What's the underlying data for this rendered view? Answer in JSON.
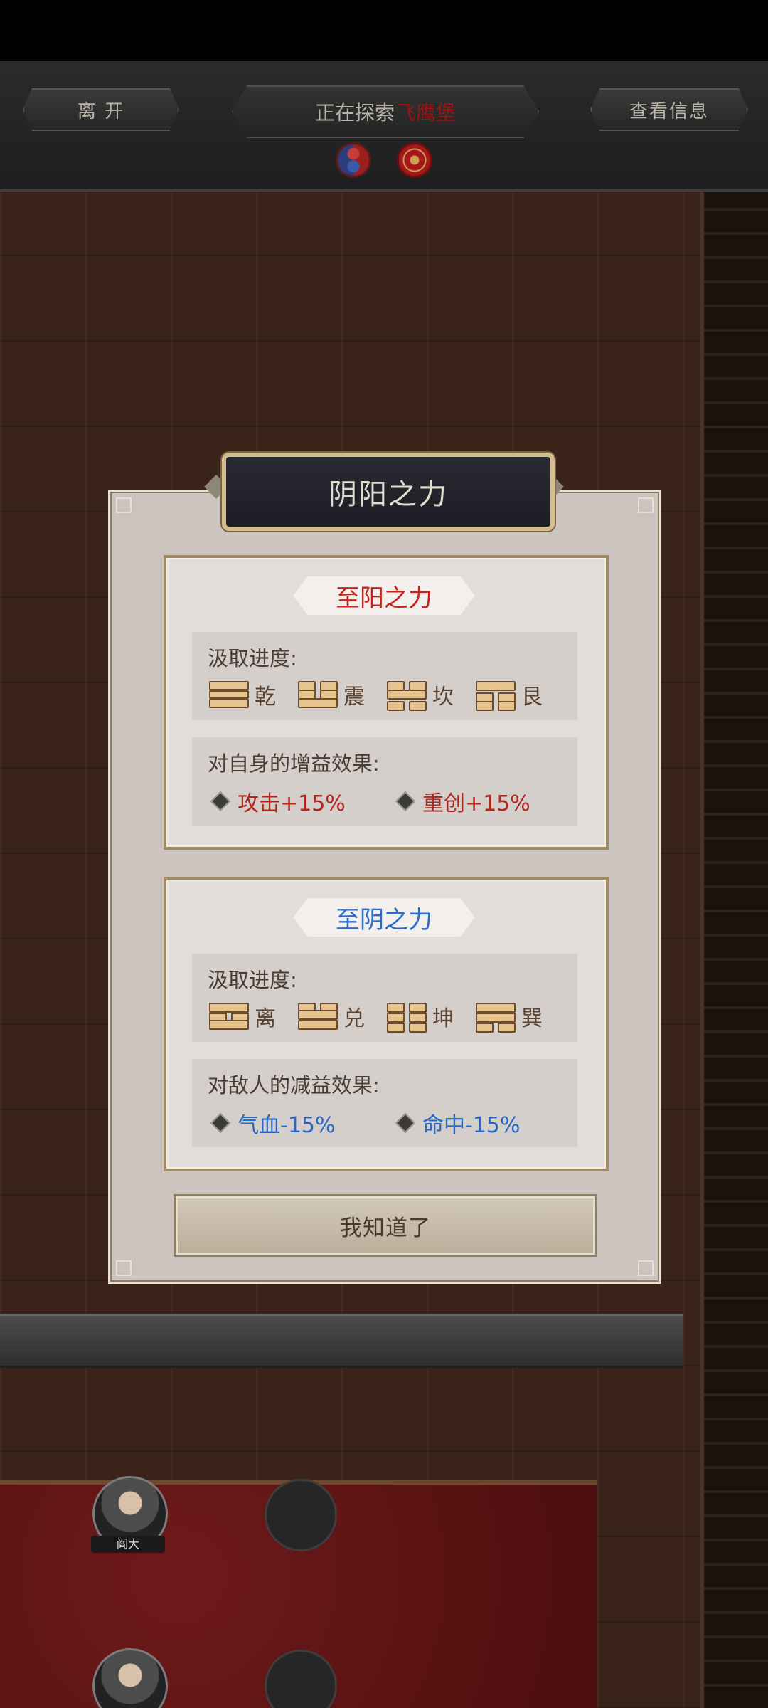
{
  "top_bar": {
    "leave_label": "离 开",
    "explore_prefix": "正在探索",
    "explore_location": "飞鹰堡",
    "info_label": "查看信息"
  },
  "icons": {
    "yinyang": "yinyang-icon",
    "bagua": "bagua-icon"
  },
  "board": {
    "character_label": "阎大"
  },
  "modal": {
    "title": "阴阳之力",
    "yang": {
      "title": "至阳之力",
      "progress_label": "汲取进度:",
      "trigrams": [
        "乾",
        "震",
        "坎",
        "艮"
      ],
      "effect_label": "对自身的增益效果:",
      "effects": [
        "攻击+15%",
        "重创+15%"
      ]
    },
    "yin": {
      "title": "至阴之力",
      "progress_label": "汲取进度:",
      "trigrams": [
        "离",
        "兑",
        "坤",
        "巽"
      ],
      "effect_label": "对敌人的减益效果:",
      "effects": [
        "气血-15%",
        "命中-15%"
      ]
    },
    "ok_label": "我知道了"
  },
  "colors": {
    "yang_text": "#c5231b",
    "yin_text": "#2a6cc9",
    "location_text": "#9a1414"
  }
}
